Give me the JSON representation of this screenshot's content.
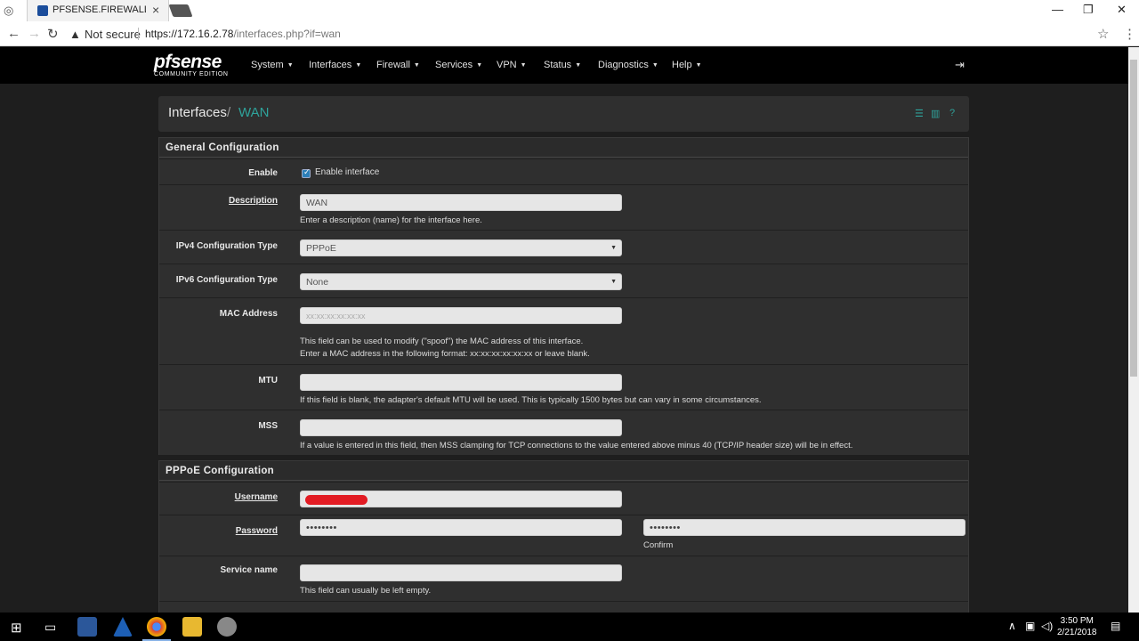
{
  "browser": {
    "tab_title": "PFSENSE.FIREWALL.COM",
    "tab_close": "×",
    "security_label": "Not secure",
    "url_scheme": "https://",
    "url_host": "172.16.2.78",
    "url_path": "/interfaces.php?if=wan",
    "window_minimize": "—",
    "window_maximize": "❐",
    "window_close": "✕"
  },
  "navbar": {
    "logo_main": "pfsense",
    "logo_sub": "COMMUNITY EDITION",
    "items": [
      {
        "label": "System"
      },
      {
        "label": "Interfaces"
      },
      {
        "label": "Firewall"
      },
      {
        "label": "Services"
      },
      {
        "label": "VPN"
      },
      {
        "label": "Status"
      },
      {
        "label": "Diagnostics"
      },
      {
        "label": "Help"
      }
    ]
  },
  "breadcrumb": {
    "root": "Interfaces",
    "separator": "/",
    "leaf": "WAN"
  },
  "general": {
    "heading": "General Configuration",
    "enable_label": "Enable",
    "enable_checkbox_text": "Enable interface",
    "enable_checked": true,
    "description_label": "Description",
    "description_value": "WAN",
    "description_help": "Enter a description (name) for the interface here.",
    "ipv4_label": "IPv4 Configuration Type",
    "ipv4_value": "PPPoE",
    "ipv6_label": "IPv6 Configuration Type",
    "ipv6_value": "None",
    "mac_label": "MAC Address",
    "mac_placeholder": "xx:xx:xx:xx:xx:xx",
    "mac_help_1": "This field can be used to modify (\"spoof\") the MAC address of this interface.",
    "mac_help_2": "Enter a MAC address in the following format: xx:xx:xx:xx:xx:xx or leave blank.",
    "mtu_label": "MTU",
    "mtu_help": "If this field is blank, the adapter's default MTU will be used. This is typically 1500 bytes but can vary in some circumstances.",
    "mss_label": "MSS",
    "mss_help": "If a value is entered in this field, then MSS clamping for TCP connections to the value entered above minus 40 (TCP/IP header size) will be in effect."
  },
  "pppoe": {
    "heading": "PPPoE Configuration",
    "username_label": "Username",
    "password_label": "Password",
    "password_mask": "••••••••",
    "confirm_mask": "••••••••",
    "confirm_label": "Confirm",
    "service_label": "Service name",
    "service_help": "This field can usually be left empty."
  },
  "taskbar": {
    "time": "3:50 PM",
    "date": "2/21/2018"
  },
  "colors": {
    "accent": "#2fa39b",
    "navbar_bg": "#000000",
    "panel_bg": "#2f2f2f",
    "page_bg": "#1e1e1e",
    "redaction": "#e21b23"
  }
}
